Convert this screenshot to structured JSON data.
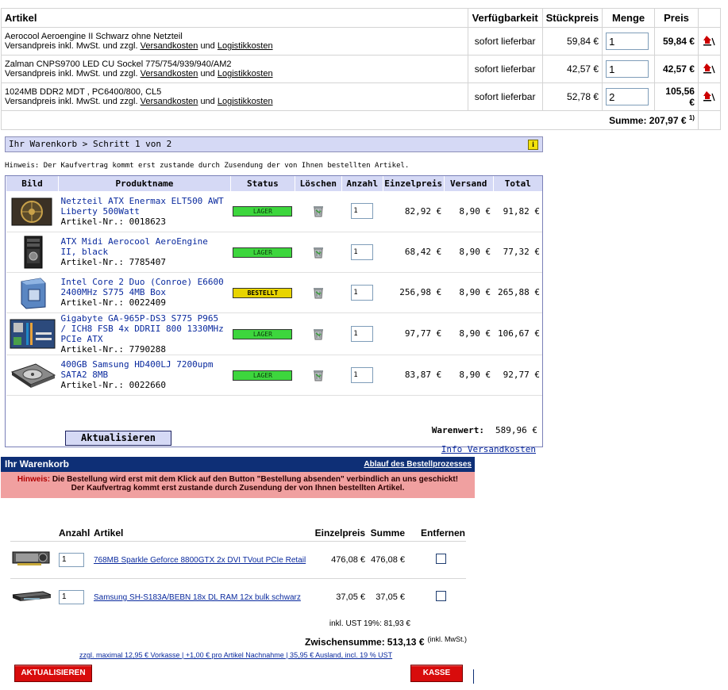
{
  "cart1": {
    "headers": {
      "article": "Artikel",
      "availability": "Verfügbarkeit",
      "unit_price": "Stückpreis",
      "quantity": "Menge",
      "price": "Preis"
    },
    "shipping_note_prefix": "Versandpreis inkl. MwSt. und zzgl.",
    "shipping_link": "Versandkosten",
    "and_text": "und",
    "logistics_link": "Logistikkosten",
    "rows": [
      {
        "name": "Aerocool Aeroengine II Schwarz ohne Netzteil",
        "availability": "sofort lieferbar",
        "unit_price": "59,84 €",
        "quantity": "1",
        "price": "59,84 €"
      },
      {
        "name": "Zalman CNPS9700 LED CU Sockel 775/754/939/940/AM2",
        "availability": "sofort lieferbar",
        "unit_price": "42,57 €",
        "quantity": "1",
        "price": "42,57 €"
      },
      {
        "name": "1024MB DDR2 MDT , PC6400/800, CL5",
        "availability": "sofort lieferbar",
        "unit_price": "52,78 €",
        "quantity": "2",
        "price": "105,56 €"
      }
    ],
    "sum_label": "Summe:",
    "sum_value": "207,97 €",
    "sum_footnote": "1)",
    "delete_icon": "cart-remove-icon",
    "accent_color": "#cc0000"
  },
  "cart2": {
    "breadcrumb": "Ihr Warenkorb > Schritt 1 von 2",
    "info_icon_label": "i",
    "hint": "Hinweis: Der Kaufvertrag kommt erst zustande durch Zusendung der von Ihnen bestellten Artikel.",
    "headers": {
      "image": "Bild",
      "product": "Produktname",
      "status": "Status",
      "delete": "Löschen",
      "quantity": "Anzahl",
      "unit_price": "Einzelpreis",
      "shipping": "Versand",
      "total": "Total"
    },
    "article_no_label": "Artikel-Nr.:",
    "rows": [
      {
        "name": "Netzteil ATX Enermax ELT500 AWT Liberty 500Watt",
        "article_no": "0018623",
        "status": "LAGER",
        "status_color": "#3dd63d",
        "quantity": "1",
        "unit_price": "82,92 €",
        "shipping": "8,90 €",
        "total": "91,82 €",
        "image": "power-supply"
      },
      {
        "name": "ATX Midi Aerocool AeroEngine II, black",
        "article_no": "7785407",
        "status": "LAGER",
        "status_color": "#3dd63d",
        "quantity": "1",
        "unit_price": "68,42 €",
        "shipping": "8,90 €",
        "total": "77,32 €",
        "image": "pc-case"
      },
      {
        "name": "Intel Core 2 Duo (Conroe) E6600 2400MHz S775 4MB Box",
        "article_no": "0022409",
        "status": "BESTELLT",
        "status_color": "#e8d400",
        "quantity": "1",
        "unit_price": "256,98 €",
        "shipping": "8,90 €",
        "total": "265,88 €",
        "image": "cpu-box"
      },
      {
        "name": "Gigabyte GA-965P-DS3 S775 P965 / ICH8 FSB 4x DDRII 800 1330MHz PCIe ATX",
        "article_no": "7790288",
        "status": "LAGER",
        "status_color": "#3dd63d",
        "quantity": "1",
        "unit_price": "97,77 €",
        "shipping": "8,90 €",
        "total": "106,67 €",
        "image": "motherboard"
      },
      {
        "name": "400GB Samsung HD400LJ 7200upm SATA2 8MB",
        "article_no": "0022660",
        "status": "LAGER",
        "status_color": "#3dd63d",
        "quantity": "1",
        "unit_price": "83,87 €",
        "shipping": "8,90 €",
        "total": "92,77 €",
        "image": "hard-disk"
      }
    ],
    "update_button": "Aktualisieren",
    "goods_value_label": "Warenwert:",
    "goods_value": "589,96 €",
    "shipping_info_link": "Info Versandkosten",
    "accent_color": "#d5d9f5"
  },
  "cart3": {
    "title": "Ihr Warenkorb",
    "process_link": "Ablauf des Bestellprozesses",
    "notice_prefix": "Hinweis:",
    "notice_line1": "Die Bestellung wird erst mit dem Klick auf den Button \"Bestellung absenden\" verbindlich an uns geschickt!",
    "notice_line2": "Der Kaufvertrag kommt erst zustande durch Zusendung der von Ihnen bestellten Artikel.",
    "headers": {
      "quantity": "Anzahl",
      "article": "Artikel",
      "unit_price": "Einzelpreis",
      "sum": "Summe",
      "remove": "Entfernen"
    },
    "rows": [
      {
        "quantity": "1",
        "name": "768MB Sparkle Geforce 8800GTX 2x DVI TVout PCIe Retail",
        "unit_price": "476,08 €",
        "sum": "476,08 €",
        "image": "graphics-card"
      },
      {
        "quantity": "1",
        "name": "Samsung SH-S183A/BEBN 18x DL RAM 12x bulk schwarz",
        "unit_price": "37,05 €",
        "sum": "37,05 €",
        "image": "dvd-drive"
      }
    ],
    "vat_text": "inkl. UST 19%: 81,93 €",
    "subtotal_label": "Zwischensumme:",
    "subtotal_value": "513,13 €",
    "subtotal_note": "(inkl. MwSt.)",
    "shipping_text": "zzgl. maximal 12,95 € Vorkasse | +1,00 € pro Artikel Nachnahme | 35,95 € Ausland, incl. 19 % UST",
    "update_button": "AKTUALISIEREN",
    "checkout_button": "KASSE",
    "bar_color": "#0e2f76",
    "notice_color": "#f0a0a0",
    "button_color": "#d80c0c"
  }
}
